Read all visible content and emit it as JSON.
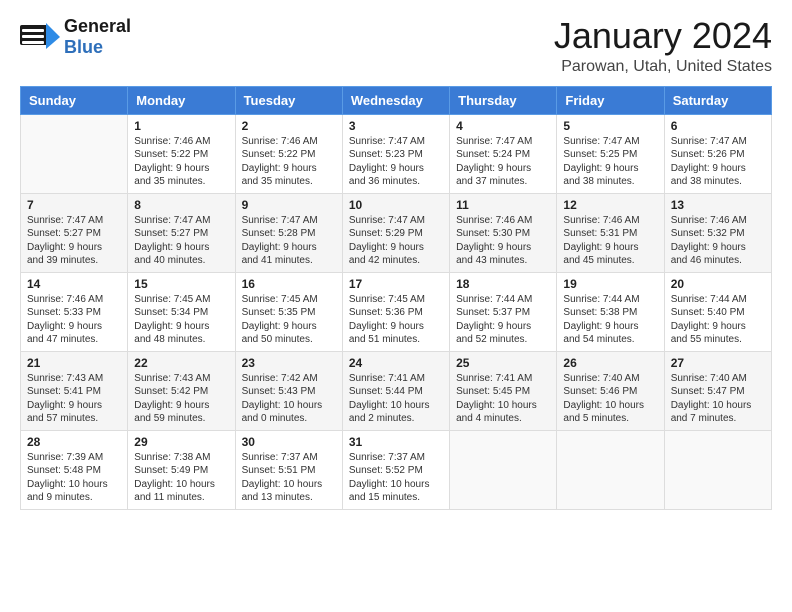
{
  "header": {
    "logo_general": "General",
    "logo_blue": "Blue",
    "title": "January 2024",
    "subtitle": "Parowan, Utah, United States"
  },
  "weekdays": [
    "Sunday",
    "Monday",
    "Tuesday",
    "Wednesday",
    "Thursday",
    "Friday",
    "Saturday"
  ],
  "weeks": [
    [
      {
        "day": "",
        "info": ""
      },
      {
        "day": "1",
        "info": "Sunrise: 7:46 AM\nSunset: 5:22 PM\nDaylight: 9 hours\nand 35 minutes."
      },
      {
        "day": "2",
        "info": "Sunrise: 7:46 AM\nSunset: 5:22 PM\nDaylight: 9 hours\nand 35 minutes."
      },
      {
        "day": "3",
        "info": "Sunrise: 7:47 AM\nSunset: 5:23 PM\nDaylight: 9 hours\nand 36 minutes."
      },
      {
        "day": "4",
        "info": "Sunrise: 7:47 AM\nSunset: 5:24 PM\nDaylight: 9 hours\nand 37 minutes."
      },
      {
        "day": "5",
        "info": "Sunrise: 7:47 AM\nSunset: 5:25 PM\nDaylight: 9 hours\nand 38 minutes."
      },
      {
        "day": "6",
        "info": "Sunrise: 7:47 AM\nSunset: 5:26 PM\nDaylight: 9 hours\nand 38 minutes."
      }
    ],
    [
      {
        "day": "7",
        "info": "Sunrise: 7:47 AM\nSunset: 5:27 PM\nDaylight: 9 hours\nand 39 minutes."
      },
      {
        "day": "8",
        "info": "Sunrise: 7:47 AM\nSunset: 5:27 PM\nDaylight: 9 hours\nand 40 minutes."
      },
      {
        "day": "9",
        "info": "Sunrise: 7:47 AM\nSunset: 5:28 PM\nDaylight: 9 hours\nand 41 minutes."
      },
      {
        "day": "10",
        "info": "Sunrise: 7:47 AM\nSunset: 5:29 PM\nDaylight: 9 hours\nand 42 minutes."
      },
      {
        "day": "11",
        "info": "Sunrise: 7:46 AM\nSunset: 5:30 PM\nDaylight: 9 hours\nand 43 minutes."
      },
      {
        "day": "12",
        "info": "Sunrise: 7:46 AM\nSunset: 5:31 PM\nDaylight: 9 hours\nand 45 minutes."
      },
      {
        "day": "13",
        "info": "Sunrise: 7:46 AM\nSunset: 5:32 PM\nDaylight: 9 hours\nand 46 minutes."
      }
    ],
    [
      {
        "day": "14",
        "info": "Sunrise: 7:46 AM\nSunset: 5:33 PM\nDaylight: 9 hours\nand 47 minutes."
      },
      {
        "day": "15",
        "info": "Sunrise: 7:45 AM\nSunset: 5:34 PM\nDaylight: 9 hours\nand 48 minutes."
      },
      {
        "day": "16",
        "info": "Sunrise: 7:45 AM\nSunset: 5:35 PM\nDaylight: 9 hours\nand 50 minutes."
      },
      {
        "day": "17",
        "info": "Sunrise: 7:45 AM\nSunset: 5:36 PM\nDaylight: 9 hours\nand 51 minutes."
      },
      {
        "day": "18",
        "info": "Sunrise: 7:44 AM\nSunset: 5:37 PM\nDaylight: 9 hours\nand 52 minutes."
      },
      {
        "day": "19",
        "info": "Sunrise: 7:44 AM\nSunset: 5:38 PM\nDaylight: 9 hours\nand 54 minutes."
      },
      {
        "day": "20",
        "info": "Sunrise: 7:44 AM\nSunset: 5:40 PM\nDaylight: 9 hours\nand 55 minutes."
      }
    ],
    [
      {
        "day": "21",
        "info": "Sunrise: 7:43 AM\nSunset: 5:41 PM\nDaylight: 9 hours\nand 57 minutes."
      },
      {
        "day": "22",
        "info": "Sunrise: 7:43 AM\nSunset: 5:42 PM\nDaylight: 9 hours\nand 59 minutes."
      },
      {
        "day": "23",
        "info": "Sunrise: 7:42 AM\nSunset: 5:43 PM\nDaylight: 10 hours\nand 0 minutes."
      },
      {
        "day": "24",
        "info": "Sunrise: 7:41 AM\nSunset: 5:44 PM\nDaylight: 10 hours\nand 2 minutes."
      },
      {
        "day": "25",
        "info": "Sunrise: 7:41 AM\nSunset: 5:45 PM\nDaylight: 10 hours\nand 4 minutes."
      },
      {
        "day": "26",
        "info": "Sunrise: 7:40 AM\nSunset: 5:46 PM\nDaylight: 10 hours\nand 5 minutes."
      },
      {
        "day": "27",
        "info": "Sunrise: 7:40 AM\nSunset: 5:47 PM\nDaylight: 10 hours\nand 7 minutes."
      }
    ],
    [
      {
        "day": "28",
        "info": "Sunrise: 7:39 AM\nSunset: 5:48 PM\nDaylight: 10 hours\nand 9 minutes."
      },
      {
        "day": "29",
        "info": "Sunrise: 7:38 AM\nSunset: 5:49 PM\nDaylight: 10 hours\nand 11 minutes."
      },
      {
        "day": "30",
        "info": "Sunrise: 7:37 AM\nSunset: 5:51 PM\nDaylight: 10 hours\nand 13 minutes."
      },
      {
        "day": "31",
        "info": "Sunrise: 7:37 AM\nSunset: 5:52 PM\nDaylight: 10 hours\nand 15 minutes."
      },
      {
        "day": "",
        "info": ""
      },
      {
        "day": "",
        "info": ""
      },
      {
        "day": "",
        "info": ""
      }
    ]
  ]
}
